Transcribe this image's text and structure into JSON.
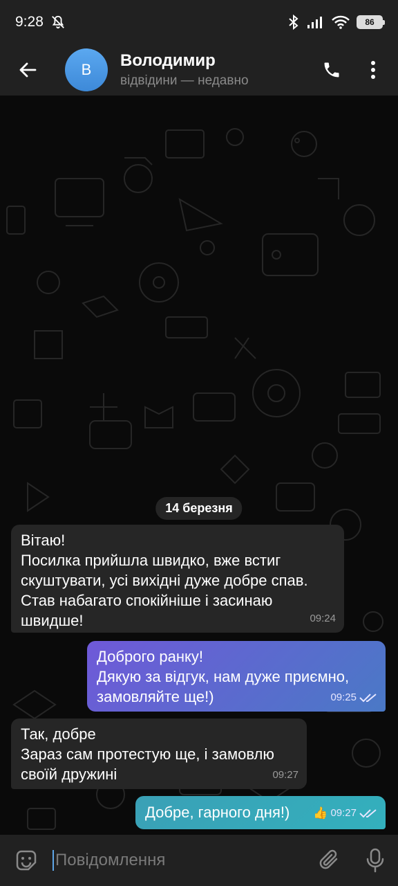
{
  "statusbar": {
    "time": "9:28",
    "battery": "86"
  },
  "header": {
    "name": "Володимир",
    "avatar_letter": "В",
    "status": "відвідини — недавно"
  },
  "chat": {
    "date": "14 березня",
    "messages": [
      {
        "dir": "in",
        "lines": [
          "Вітаю!",
          "Посилка прийшла швидко, вже встиг",
          "скуштувати, усі вихідні дуже добре спав.",
          "Став набагато спокійніше і засинаю",
          "швидше!"
        ],
        "time": "09:24"
      },
      {
        "dir": "out",
        "lines": [
          "Доброго ранку!",
          "Дякую за відгук, нам дуже приємно,",
          "замовляйте ще!)"
        ],
        "time": "09:25"
      },
      {
        "dir": "in",
        "lines": [
          "Так, добре",
          "Зараз сам протестую ще, і замовлю",
          "своїй дружині"
        ],
        "time": "09:27"
      },
      {
        "dir": "out",
        "lines": [
          "Добре, гарного дня!)"
        ],
        "reaction": "👍",
        "time": "09:27"
      }
    ]
  },
  "input": {
    "placeholder": "Повідомлення"
  },
  "colors": {
    "bar": "#212121",
    "incoming": "#262626",
    "outgoing_start": "#6f59d8",
    "outgoing_end": "#4a79c6",
    "accent": "#5fa7e8"
  }
}
